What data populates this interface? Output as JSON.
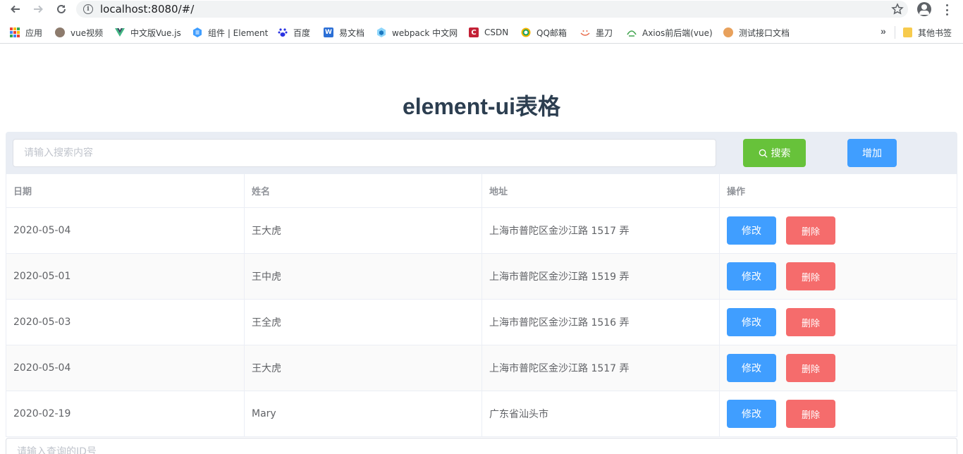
{
  "browser": {
    "url_host": "localhost",
    "url_rest": ":8080/#/",
    "bookmarks": [
      {
        "label": "应用",
        "icon": "apps-grid-icon"
      },
      {
        "label": "vue视频",
        "icon": "avatar-photo-icon"
      },
      {
        "label": "中文版Vue.js",
        "icon": "vue-logo-icon"
      },
      {
        "label": "组件 | Element",
        "icon": "element-logo-icon"
      },
      {
        "label": "百度",
        "icon": "baidu-paw-icon"
      },
      {
        "label": "易文档",
        "icon": "word-doc-icon"
      },
      {
        "label": "webpack 中文网",
        "icon": "webpack-cube-icon"
      },
      {
        "label": "CSDN",
        "icon": "csdn-logo-icon"
      },
      {
        "label": "QQ邮箱",
        "icon": "qq-mail-icon"
      },
      {
        "label": "墨刀",
        "icon": "modao-icon"
      },
      {
        "label": "Axios前后端(vue)",
        "icon": "axios-icon"
      },
      {
        "label": "测试接口文档",
        "icon": "doc-orange-icon"
      }
    ],
    "more_label": "»",
    "other_bookmarks": "其他书签"
  },
  "page": {
    "title": "element-ui表格"
  },
  "toolbar": {
    "search_placeholder": "请输入搜索内容",
    "search_label": "搜索",
    "add_label": "增加"
  },
  "table": {
    "headers": [
      "日期",
      "姓名",
      "地址",
      "操作"
    ],
    "rows": [
      {
        "date": "2020-05-04",
        "name": "王大虎",
        "address": "上海市普陀区金沙江路 1517 弄"
      },
      {
        "date": "2020-05-01",
        "name": "王中虎",
        "address": "上海市普陀区金沙江路 1519 弄"
      },
      {
        "date": "2020-05-03",
        "name": "王全虎",
        "address": "上海市普陀区金沙江路 1516 弄"
      },
      {
        "date": "2020-05-04",
        "name": "王大虎",
        "address": "上海市普陀区金沙江路 1517 弄"
      },
      {
        "date": "2020-02-19",
        "name": "Mary",
        "address": "广东省汕头市"
      }
    ],
    "edit_label": "修改",
    "delete_label": "删除"
  },
  "bottom": {
    "id_placeholder": "请输入查询的ID号"
  },
  "colors": {
    "primary": "#409eff",
    "success": "#67c23a",
    "danger": "#f56c6c",
    "title": "#2c3e50"
  }
}
